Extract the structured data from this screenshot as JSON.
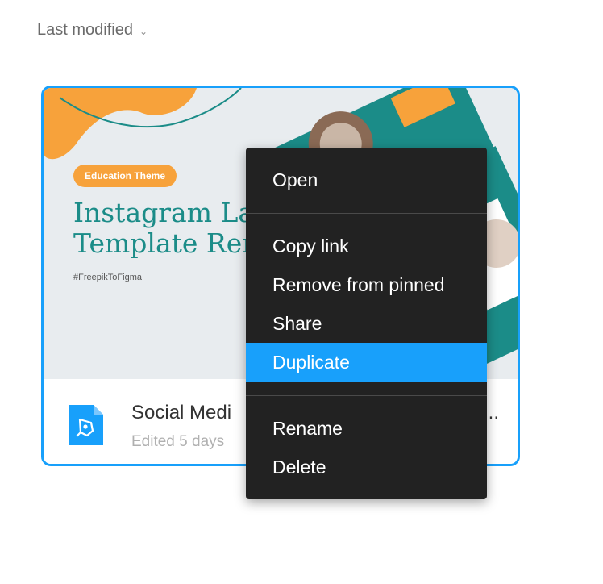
{
  "sort": {
    "label": "Last modified",
    "icon": "chevron-down-icon"
  },
  "card": {
    "thumbnail": {
      "badge": "Education Theme",
      "title": "Instagram La\nTemplate Ren",
      "hashtag": "#FreepikToFigma",
      "colors": {
        "teal": "#1b8c88",
        "orange": "#f7a23b",
        "background": "#e8ecef"
      }
    },
    "file_name": "Social Medi",
    "file_name_tail": "...",
    "meta": "Edited 5 days",
    "file_icon": "figma-file-icon"
  },
  "context_menu": {
    "items": [
      {
        "label": "Open"
      },
      {
        "label": "Copy link"
      },
      {
        "label": "Remove from pinned"
      },
      {
        "label": "Share"
      },
      {
        "label": "Duplicate",
        "highlighted": true
      },
      {
        "label": "Rename"
      },
      {
        "label": "Delete"
      }
    ],
    "highlight_color": "#18a0fb"
  }
}
